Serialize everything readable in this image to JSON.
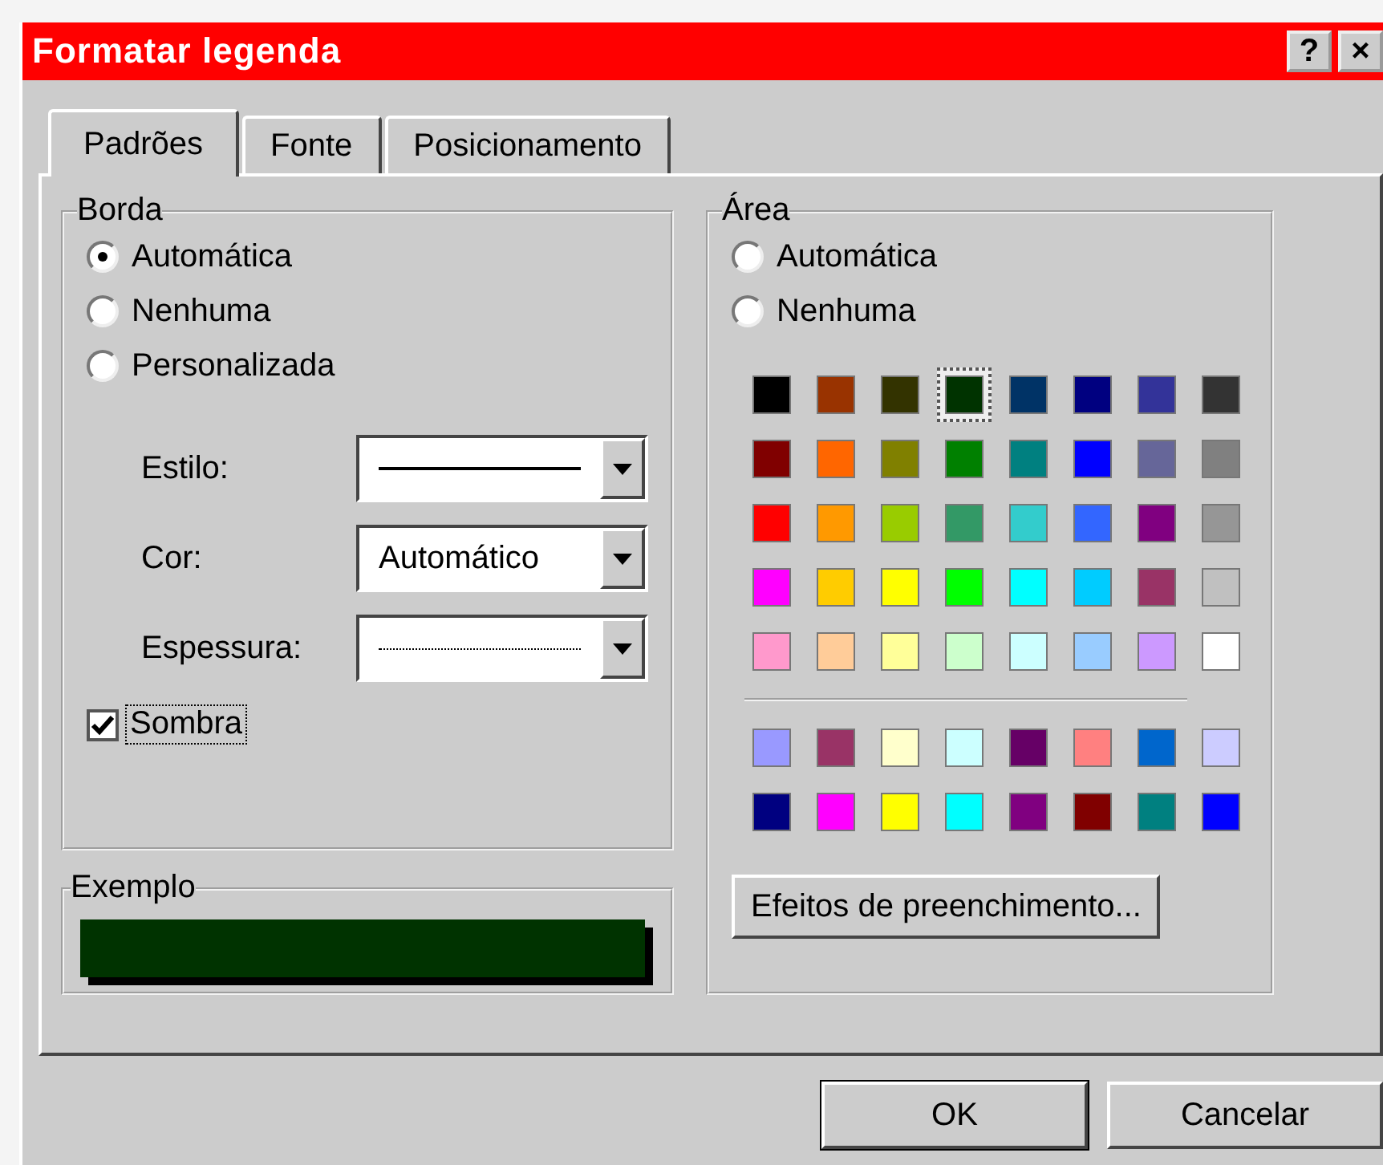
{
  "window": {
    "title": "Formatar legenda",
    "title_buttons": [
      "?",
      "×"
    ]
  },
  "tabs": [
    {
      "label": "Padrões",
      "selected": true
    },
    {
      "label": "Fonte",
      "selected": false
    },
    {
      "label": "Posicionamento",
      "selected": false
    }
  ],
  "border": {
    "title": "Borda",
    "options": [
      {
        "label": "Automática",
        "selected": true
      },
      {
        "label": "Nenhuma",
        "selected": false
      },
      {
        "label": "Personalizada",
        "selected": false
      }
    ],
    "fields": [
      {
        "label": "Estilo:",
        "kind": "solid-line"
      },
      {
        "label": "Cor:",
        "kind": "text",
        "value": "Automático"
      },
      {
        "label": "Espessura:",
        "kind": "dotted-line"
      }
    ],
    "shadow": {
      "label": "Sombra",
      "checked": true
    }
  },
  "sample": {
    "title": "Exemplo"
  },
  "area": {
    "title": "Área",
    "options": [
      {
        "label": "Automática",
        "selected": false
      },
      {
        "label": "Nenhuma",
        "selected": false
      }
    ],
    "standard_colors": [
      [
        {
          "color": "#000000",
          "selected": false
        },
        {
          "color": "#993300",
          "selected": false
        },
        {
          "color": "#333300",
          "selected": false
        },
        {
          "color": "#003300",
          "selected": true
        },
        {
          "color": "#003366",
          "selected": false
        },
        {
          "color": "#000080",
          "selected": false
        },
        {
          "color": "#333399",
          "selected": false
        },
        {
          "color": "#333333",
          "selected": false
        }
      ],
      [
        {
          "color": "#800000",
          "selected": false
        },
        {
          "color": "#ff6600",
          "selected": false
        },
        {
          "color": "#808000",
          "selected": false
        },
        {
          "color": "#008000",
          "selected": false
        },
        {
          "color": "#008080",
          "selected": false
        },
        {
          "color": "#0000ff",
          "selected": false
        },
        {
          "color": "#666699",
          "selected": false
        },
        {
          "color": "#808080",
          "selected": false
        }
      ],
      [
        {
          "color": "#ff0000",
          "selected": false
        },
        {
          "color": "#ff9900",
          "selected": false
        },
        {
          "color": "#99cc00",
          "selected": false
        },
        {
          "color": "#339966",
          "selected": false
        },
        {
          "color": "#33cccc",
          "selected": false
        },
        {
          "color": "#3366ff",
          "selected": false
        },
        {
          "color": "#800080",
          "selected": false
        },
        {
          "color": "#969696",
          "selected": false
        }
      ],
      [
        {
          "color": "#ff00ff",
          "selected": false
        },
        {
          "color": "#ffcc00",
          "selected": false
        },
        {
          "color": "#ffff00",
          "selected": false
        },
        {
          "color": "#00ff00",
          "selected": false
        },
        {
          "color": "#00ffff",
          "selected": false
        },
        {
          "color": "#00ccff",
          "selected": false
        },
        {
          "color": "#993366",
          "selected": false
        },
        {
          "color": "#c0c0c0",
          "selected": false
        }
      ],
      [
        {
          "color": "#ff99cc",
          "selected": false
        },
        {
          "color": "#ffcc99",
          "selected": false
        },
        {
          "color": "#ffff99",
          "selected": false
        },
        {
          "color": "#ccffcc",
          "selected": false
        },
        {
          "color": "#ccffff",
          "selected": false
        },
        {
          "color": "#99ccff",
          "selected": false
        },
        {
          "color": "#cc99ff",
          "selected": false
        },
        {
          "color": "#ffffff",
          "selected": false
        }
      ]
    ],
    "chart_colors": [
      [
        {
          "color": "#9999ff",
          "selected": false
        },
        {
          "color": "#993366",
          "selected": false
        },
        {
          "color": "#ffffcc",
          "selected": false
        },
        {
          "color": "#ccffff",
          "selected": false
        },
        {
          "color": "#660066",
          "selected": false
        },
        {
          "color": "#ff8080",
          "selected": false
        },
        {
          "color": "#0066cc",
          "selected": false
        },
        {
          "color": "#ccccff",
          "selected": false
        }
      ],
      [
        {
          "color": "#000080",
          "selected": false
        },
        {
          "color": "#ff00ff",
          "selected": false
        },
        {
          "color": "#ffff00",
          "selected": false
        },
        {
          "color": "#00ffff",
          "selected": false
        },
        {
          "color": "#800080",
          "selected": false
        },
        {
          "color": "#800000",
          "selected": false
        },
        {
          "color": "#008080",
          "selected": false
        },
        {
          "color": "#0000ff",
          "selected": false
        }
      ]
    ],
    "fill_effects_button": "Efeitos de preenchimento..."
  },
  "buttons": [
    "OK",
    "Cancelar"
  ]
}
